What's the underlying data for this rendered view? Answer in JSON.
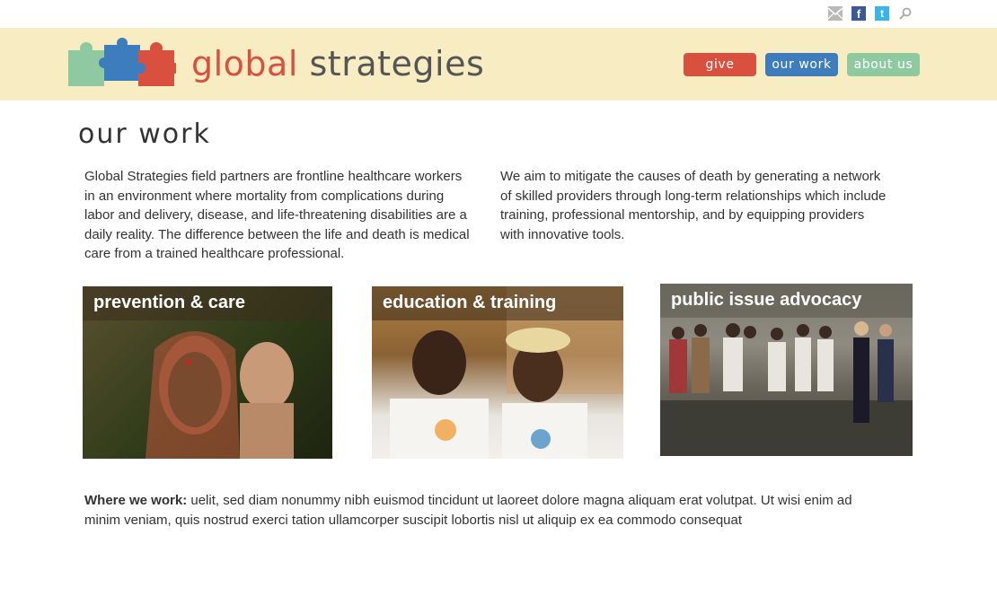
{
  "topbar": {
    "icons": [
      "mail-icon",
      "facebook-icon",
      "twitter-icon",
      "search-icon"
    ],
    "facebook_glyph": "f",
    "twitter_glyph": "t"
  },
  "brand": {
    "word1": "global",
    "word2": "strategies",
    "colors": {
      "red": "#d9503f",
      "blue": "#3e7dbd",
      "green": "#8fc9a1",
      "banner": "#f7ecc2"
    }
  },
  "nav": {
    "give": "give",
    "our_work": "our work",
    "about_us": "about us"
  },
  "page": {
    "title": "our work",
    "intro_left": "Global Strategies field partners are frontline healthcare workers in an environment where mortality from complications during labor and delivery, disease, and life-threatening disabilities are a daily reality.  The difference between the life and death is medical care from a trained healthcare professional.",
    "intro_right": "We aim to mitigate the causes of death by generating a network of skilled providers through long-term relationships which include training, professional mentorship, and by equipping providers with innovative tools."
  },
  "cards": [
    {
      "label": "prevention & care"
    },
    {
      "label": "education & training"
    },
    {
      "label": "public issue advocacy"
    }
  ],
  "where": {
    "heading": "Where we work: ",
    "body": "uelit, sed diam nonummy nibh euismod tincidunt ut laoreet dolore magna aliquam erat volutpat. Ut wisi enim ad minim veniam, quis nostrud exerci tation ullamcorper suscipit lobortis nisl ut aliquip ex ea commodo consequat"
  }
}
